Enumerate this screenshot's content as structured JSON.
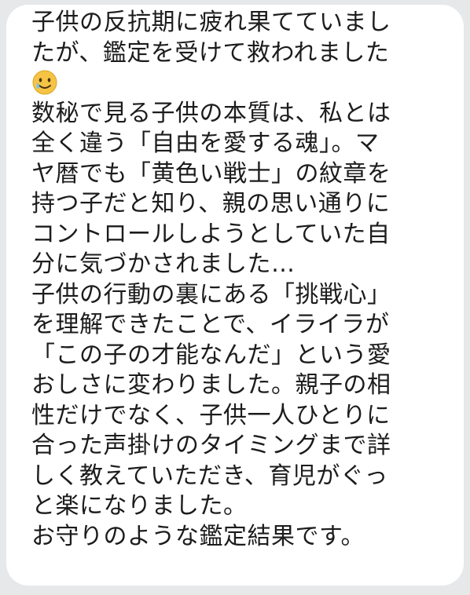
{
  "message": {
    "lines": [
      "子供の反抗期に疲れ果てていまし",
      "たが、鑑定を受けて救われました",
      "",
      "数秘で見る子供の本質は、私とは",
      "全く違う「自由を愛する魂」。マ",
      "ヤ暦でも「黄色い戦士」の紋章を",
      "持つ子だと知り、親の思い通りに",
      "コントロールしようとしていた自",
      "分に気づかされました…",
      "子供の行動の裏にある「挑戦心」",
      "を理解できたことで、イライラが",
      "「この子の才能なんだ」という愛",
      "おしさに変わりました。親子の相",
      "性だけでなく、子供一人ひとりに",
      "合った声掛けのタイミングまで詳",
      "しく教えていただき、育児がぐっ",
      "と楽になりました。",
      "お守りのような鑑定結果です。"
    ],
    "emoji_icon": "smiling-face-with-tear-icon"
  },
  "colors": {
    "background": "#e6e8ea",
    "bubble": "#ffffff",
    "text": "#1c1c1c",
    "emoji_face": "#f6c445",
    "emoji_tear": "#74c3f0"
  }
}
